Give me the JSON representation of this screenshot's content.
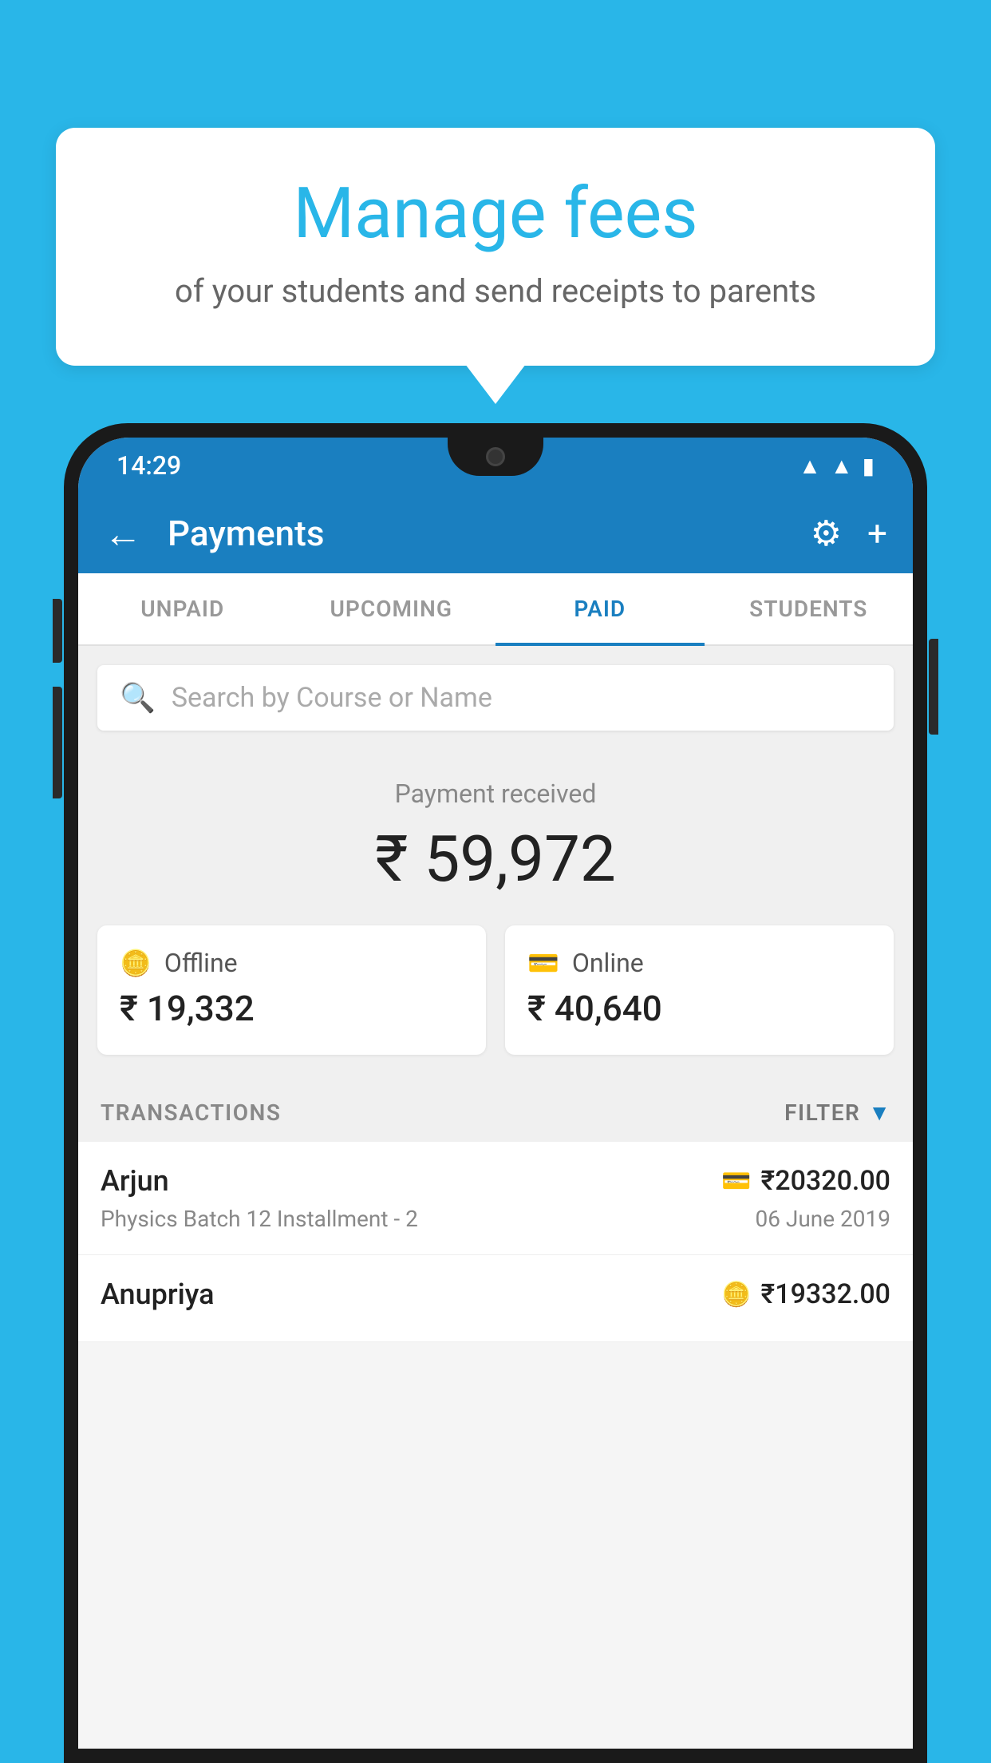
{
  "background_color": "#29b6e8",
  "bubble": {
    "title": "Manage fees",
    "subtitle": "of your students and send receipts to parents"
  },
  "status_bar": {
    "time": "14:29",
    "icons": [
      "wifi",
      "signal",
      "battery"
    ]
  },
  "app_bar": {
    "title": "Payments",
    "back_label": "←",
    "settings_label": "⚙",
    "add_label": "+"
  },
  "tabs": [
    {
      "label": "UNPAID",
      "active": false
    },
    {
      "label": "UPCOMING",
      "active": false
    },
    {
      "label": "PAID",
      "active": true
    },
    {
      "label": "STUDENTS",
      "active": false
    }
  ],
  "search": {
    "placeholder": "Search by Course or Name"
  },
  "payment_summary": {
    "label": "Payment received",
    "amount": "₹ 59,972"
  },
  "payment_cards": [
    {
      "type": "Offline",
      "amount": "₹ 19,332",
      "icon": "💳"
    },
    {
      "type": "Online",
      "amount": "₹ 40,640",
      "icon": "💳"
    }
  ],
  "transactions_header": {
    "label": "TRANSACTIONS",
    "filter_label": "FILTER"
  },
  "transactions": [
    {
      "name": "Arjun",
      "course": "Physics Batch 12 Installment - 2",
      "amount": "₹20320.00",
      "date": "06 June 2019",
      "icon": "card"
    },
    {
      "name": "Anupriya",
      "course": "",
      "amount": "₹19332.00",
      "date": "",
      "icon": "cash"
    }
  ]
}
